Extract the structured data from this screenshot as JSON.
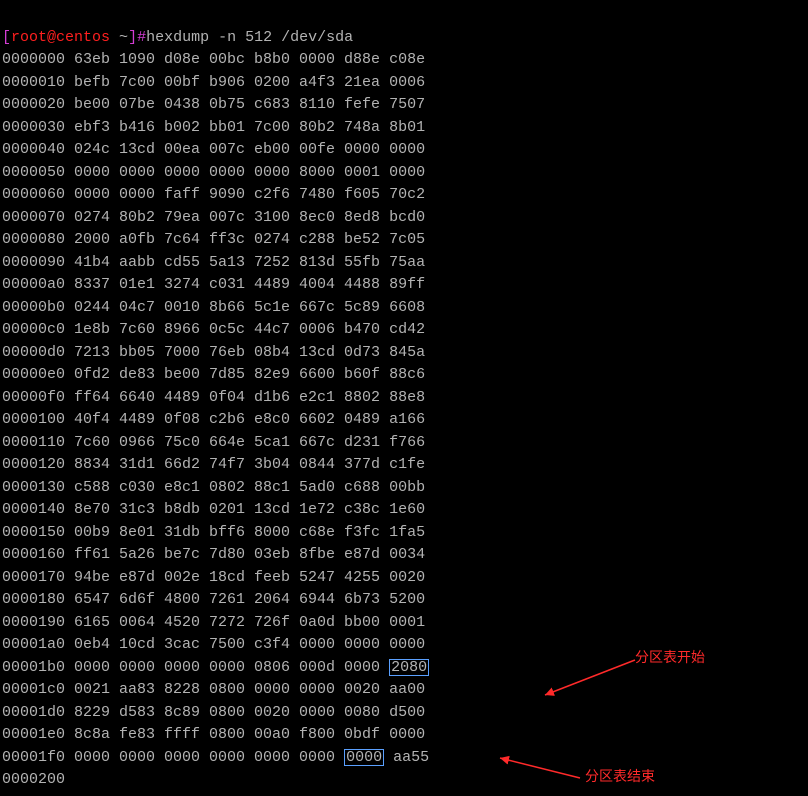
{
  "prompt": {
    "open": "[",
    "user_host": "root@centos",
    "tilde": " ~",
    "close": "]",
    "hash": "#"
  },
  "command": "hexdump -n 512 /dev/sda",
  "rows": [
    {
      "addr": "0000000",
      "w": [
        "63eb",
        "1090",
        "d08e",
        "00bc",
        "b8b0",
        "0000",
        "d88e",
        "c08e"
      ]
    },
    {
      "addr": "0000010",
      "w": [
        "befb",
        "7c00",
        "00bf",
        "b906",
        "0200",
        "a4f3",
        "21ea",
        "0006"
      ]
    },
    {
      "addr": "0000020",
      "w": [
        "be00",
        "07be",
        "0438",
        "0b75",
        "c683",
        "8110",
        "fefe",
        "7507"
      ]
    },
    {
      "addr": "0000030",
      "w": [
        "ebf3",
        "b416",
        "b002",
        "bb01",
        "7c00",
        "80b2",
        "748a",
        "8b01"
      ]
    },
    {
      "addr": "0000040",
      "w": [
        "024c",
        "13cd",
        "00ea",
        "007c",
        "eb00",
        "00fe",
        "0000",
        "0000"
      ]
    },
    {
      "addr": "0000050",
      "w": [
        "0000",
        "0000",
        "0000",
        "0000",
        "0000",
        "8000",
        "0001",
        "0000"
      ]
    },
    {
      "addr": "0000060",
      "w": [
        "0000",
        "0000",
        "faff",
        "9090",
        "c2f6",
        "7480",
        "f605",
        "70c2"
      ]
    },
    {
      "addr": "0000070",
      "w": [
        "0274",
        "80b2",
        "79ea",
        "007c",
        "3100",
        "8ec0",
        "8ed8",
        "bcd0"
      ]
    },
    {
      "addr": "0000080",
      "w": [
        "2000",
        "a0fb",
        "7c64",
        "ff3c",
        "0274",
        "c288",
        "be52",
        "7c05"
      ]
    },
    {
      "addr": "0000090",
      "w": [
        "41b4",
        "aabb",
        "cd55",
        "5a13",
        "7252",
        "813d",
        "55fb",
        "75aa"
      ]
    },
    {
      "addr": "00000a0",
      "w": [
        "8337",
        "01e1",
        "3274",
        "c031",
        "4489",
        "4004",
        "4488",
        "89ff"
      ]
    },
    {
      "addr": "00000b0",
      "w": [
        "0244",
        "04c7",
        "0010",
        "8b66",
        "5c1e",
        "667c",
        "5c89",
        "6608"
      ]
    },
    {
      "addr": "00000c0",
      "w": [
        "1e8b",
        "7c60",
        "8966",
        "0c5c",
        "44c7",
        "0006",
        "b470",
        "cd42"
      ]
    },
    {
      "addr": "00000d0",
      "w": [
        "7213",
        "bb05",
        "7000",
        "76eb",
        "08b4",
        "13cd",
        "0d73",
        "845a"
      ]
    },
    {
      "addr": "00000e0",
      "w": [
        "0fd2",
        "de83",
        "be00",
        "7d85",
        "82e9",
        "6600",
        "b60f",
        "88c6"
      ]
    },
    {
      "addr": "00000f0",
      "w": [
        "ff64",
        "6640",
        "4489",
        "0f04",
        "d1b6",
        "e2c1",
        "8802",
        "88e8"
      ]
    },
    {
      "addr": "0000100",
      "w": [
        "40f4",
        "4489",
        "0f08",
        "c2b6",
        "e8c0",
        "6602",
        "0489",
        "a166"
      ]
    },
    {
      "addr": "0000110",
      "w": [
        "7c60",
        "0966",
        "75c0",
        "664e",
        "5ca1",
        "667c",
        "d231",
        "f766"
      ]
    },
    {
      "addr": "0000120",
      "w": [
        "8834",
        "31d1",
        "66d2",
        "74f7",
        "3b04",
        "0844",
        "377d",
        "c1fe"
      ]
    },
    {
      "addr": "0000130",
      "w": [
        "c588",
        "c030",
        "e8c1",
        "0802",
        "88c1",
        "5ad0",
        "c688",
        "00bb"
      ]
    },
    {
      "addr": "0000140",
      "w": [
        "8e70",
        "31c3",
        "b8db",
        "0201",
        "13cd",
        "1e72",
        "c38c",
        "1e60"
      ]
    },
    {
      "addr": "0000150",
      "w": [
        "00b9",
        "8e01",
        "31db",
        "bff6",
        "8000",
        "c68e",
        "f3fc",
        "1fa5"
      ]
    },
    {
      "addr": "0000160",
      "w": [
        "ff61",
        "5a26",
        "be7c",
        "7d80",
        "03eb",
        "8fbe",
        "e87d",
        "0034"
      ]
    },
    {
      "addr": "0000170",
      "w": [
        "94be",
        "e87d",
        "002e",
        "18cd",
        "feeb",
        "5247",
        "4255",
        "0020"
      ]
    },
    {
      "addr": "0000180",
      "w": [
        "6547",
        "6d6f",
        "4800",
        "7261",
        "2064",
        "6944",
        "6b73",
        "5200"
      ]
    },
    {
      "addr": "0000190",
      "w": [
        "6165",
        "0064",
        "4520",
        "7272",
        "726f",
        "0a0d",
        "bb00",
        "0001"
      ]
    },
    {
      "addr": "00001a0",
      "w": [
        "0eb4",
        "10cd",
        "3cac",
        "7500",
        "c3f4",
        "0000",
        "0000",
        "0000"
      ]
    },
    {
      "addr": "00001b0",
      "w": [
        "0000",
        "0000",
        "0000",
        "0000",
        "0806",
        "000d",
        "0000",
        "2080"
      ]
    },
    {
      "addr": "00001c0",
      "w": [
        "0021",
        "aa83",
        "8228",
        "0800",
        "0000",
        "0000",
        "0020",
        "aa00"
      ]
    },
    {
      "addr": "00001d0",
      "w": [
        "8229",
        "d583",
        "8c89",
        "0800",
        "0020",
        "0000",
        "0080",
        "d500"
      ]
    },
    {
      "addr": "00001e0",
      "w": [
        "8c8a",
        "fe83",
        "ffff",
        "0800",
        "00a0",
        "f800",
        "0bdf",
        "0000"
      ]
    },
    {
      "addr": "00001f0",
      "w": [
        "0000",
        "0000",
        "0000",
        "0000",
        "0000",
        "0000",
        "0000",
        "aa55"
      ]
    },
    {
      "addr": "0000200",
      "w": []
    }
  ],
  "highlight_cells": [
    {
      "row": 27,
      "col": 7
    },
    {
      "row": 31,
      "col": 6
    }
  ],
  "annotations": {
    "start": "分区表开始",
    "end": "分区表结束"
  }
}
